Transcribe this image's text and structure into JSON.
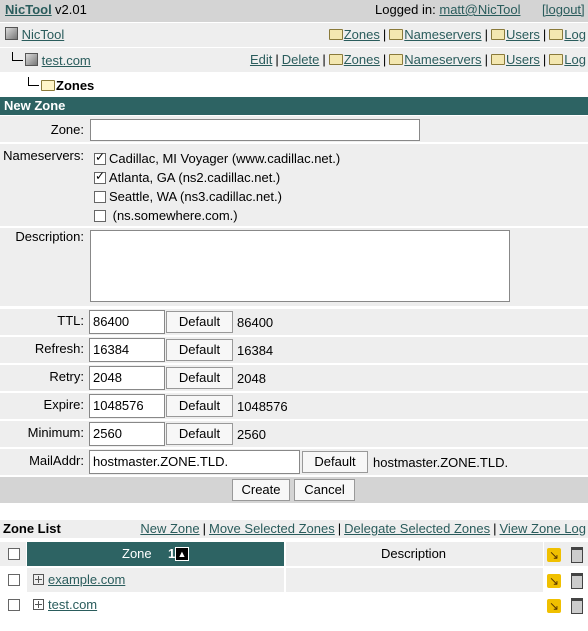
{
  "topbar": {
    "brand": "NicTool",
    "version": "v2.01",
    "logged_in_label": "Logged in:",
    "user": "matt@NicTool",
    "logout": "[logout]"
  },
  "nav1": {
    "label": "NicTool",
    "links": [
      "Zones",
      "Nameservers",
      "Users",
      "Log"
    ]
  },
  "nav2": {
    "label": "test.com",
    "edit": "Edit",
    "delete": "Delete",
    "links": [
      "Zones",
      "Nameservers",
      "Users",
      "Log"
    ]
  },
  "nav3": {
    "label": "Zones"
  },
  "new_zone": {
    "header": "New Zone",
    "zone_label": "Zone:",
    "zone_value": "",
    "nameservers_label": "Nameservers:",
    "nameservers": [
      {
        "label": "Cadillac, MI Voyager (www.cadillac.net.)",
        "checked": true
      },
      {
        "label": "Atlanta, GA (ns2.cadillac.net.)",
        "checked": true
      },
      {
        "label": "Seattle, WA (ns3.cadillac.net.)",
        "checked": false
      },
      {
        "label": " (ns.somewhere.com.)",
        "checked": false
      }
    ],
    "description_label": "Description:",
    "description_value": "",
    "fields": [
      {
        "label": "TTL:",
        "value": "86400",
        "button": "Default",
        "default": "86400"
      },
      {
        "label": "Refresh:",
        "value": "16384",
        "button": "Default",
        "default": "16384"
      },
      {
        "label": "Retry:",
        "value": "2048",
        "button": "Default",
        "default": "2048"
      },
      {
        "label": "Expire:",
        "value": "1048576",
        "button": "Default",
        "default": "1048576"
      },
      {
        "label": "Minimum:",
        "value": "2560",
        "button": "Default",
        "default": "2560"
      },
      {
        "label": "MailAddr:",
        "value": "hostmaster.ZONE.TLD.",
        "button": "Default",
        "default": "hostmaster.ZONE.TLD."
      }
    ],
    "create": "Create",
    "cancel": "Cancel"
  },
  "zone_list": {
    "title": "Zone List",
    "links": [
      "New Zone",
      "Move Selected Zones",
      "Delegate Selected Zones",
      "View Zone Log"
    ],
    "col_zone": "Zone",
    "sort_num": "1",
    "sort_icon": "sort-ascending-icon",
    "col_description": "Description",
    "rows": [
      {
        "zone": "example.com",
        "description": ""
      },
      {
        "zone": "test.com",
        "description": ""
      }
    ]
  },
  "colors": {
    "accent": "#2d6363",
    "panel": "#eeeeee",
    "topbar": "#d4d4d4",
    "link": "#2a5c5c"
  }
}
